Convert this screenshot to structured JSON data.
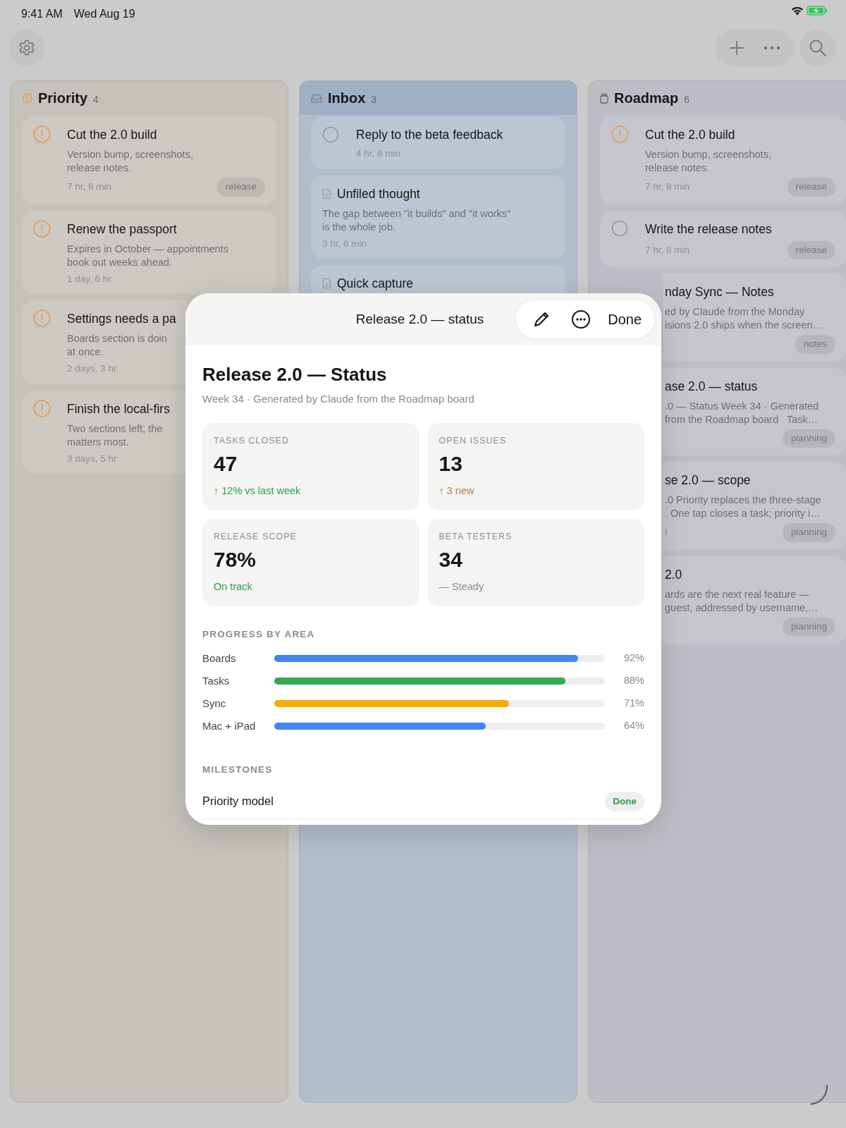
{
  "status_bar": {
    "time": "9:41 AM",
    "date": "Wed Aug 19"
  },
  "columns": [
    {
      "kind": "priority",
      "name": "Priority",
      "count": "4",
      "selected": false,
      "color": "#c5c1bb",
      "cards": [
        {
          "kind": "priority",
          "title": "Cut the 2.0 build",
          "description": "Version bump, screenshots,\nrelease notes.",
          "meta": "7 hr, 8 min",
          "tag": "release",
          "clipped": false
        },
        {
          "kind": "priority",
          "title": "Renew the passport",
          "description": "Expires in October — appointments\nbook out weeks ahead.",
          "meta": "1 day, 6 hr",
          "clipped": false
        },
        {
          "kind": "priority",
          "title": "Settings needs a pa",
          "description": "Boards section is doin\nat once.",
          "meta": "2 days, 3 hr",
          "clipped": true
        },
        {
          "kind": "priority",
          "title": "Finish the local-firs",
          "description": "Two sections left; the\nmatters most.",
          "meta": "3 days, 5 hr",
          "clipped": true
        }
      ]
    },
    {
      "kind": "inbox",
      "name": "Inbox",
      "count": "3",
      "selected": true,
      "color": "#b2bdcc",
      "cards": [
        {
          "kind": "task",
          "title": "Reply to the beta feedback",
          "meta": "4 hr, 8 min",
          "clipped": false
        },
        {
          "kind": "note",
          "title": "Unfiled thought",
          "description": "The gap between \"it builds\" and \"it works\"\nis the whole job.",
          "meta": "3 hr, 8 min",
          "clipped": false
        },
        {
          "kind": "note",
          "title": "Quick capture",
          "clipped": false
        }
      ]
    },
    {
      "kind": "project",
      "name": "Roadmap",
      "count": "6",
      "selected": false,
      "color": "#bdbec5",
      "cards": [
        {
          "kind": "priority",
          "title": "Cut the 2.0 build",
          "description": "Version bump, screenshots,\nrelease notes.",
          "meta": "7 hr, 8 min",
          "tag": "release",
          "clipped": false
        },
        {
          "kind": "task",
          "title": "Write the release notes",
          "meta": "7 hr, 8 min",
          "tag": "release",
          "clipped": false
        },
        {
          "kind": "note",
          "title": "nday Sync — Notes",
          "description": "ed by Claude from the Monday\nisions 2.0 ships when the screen…",
          "tag": "notes",
          "clipped": true
        },
        {
          "kind": "note",
          "title": "ase 2.0 — status",
          "description": ".0 — Status Week 34 · Generated\nfrom the Roadmap board   Task…",
          "tag": "planning",
          "clipped": true
        },
        {
          "kind": "note",
          "title": "se 2.0 — scope",
          "description": ".0 Priority replaces the three-stage\n. One tap closes a task; priority i…",
          "meta": "r",
          "tag": "planning",
          "clipped": true
        },
        {
          "kind": "note",
          "title": "2.0",
          "description": "ards are the next real feature —\nguest, addressed by username,…",
          "tag": "planning",
          "clipped": true
        }
      ]
    }
  ],
  "sheet": {
    "header_title": "Release 2.0 — status",
    "done": "Done",
    "title": "Release 2.0 — Status",
    "subtitle": "Week 34 · Generated by Claude from the Roadmap board",
    "stats": [
      {
        "label": "TASKS CLOSED",
        "value": "47",
        "note": "↑ 12% vs last week",
        "color": "#2e9e48"
      },
      {
        "label": "OPEN ISSUES",
        "value": "13",
        "note": "↑ 3 new",
        "color": "#b7793a"
      },
      {
        "label": "RELEASE SCOPE",
        "value": "78%",
        "note": "On track",
        "color": "#2e9e48"
      },
      {
        "label": "BETA TESTERS",
        "value": "34",
        "note": "— Steady",
        "color": "#8a8a8a"
      }
    ],
    "progress_title": "PROGRESS BY AREA",
    "areas": [
      {
        "name": "Boards",
        "level": 0.92,
        "reading": "92%",
        "color": "#4285f4"
      },
      {
        "name": "Tasks",
        "level": 0.88,
        "reading": "88%",
        "color": "#34a853"
      },
      {
        "name": "Sync",
        "level": 0.71,
        "reading": "71%",
        "color": "#f9ab00"
      },
      {
        "name": "Mac + iPad",
        "level": 0.64,
        "reading": "64%",
        "color": "#4285f4"
      }
    ],
    "milestones_title": "MILESTONES",
    "milestones": [
      {
        "name": "Priority model",
        "status": "Done",
        "kind": "done"
      }
    ]
  }
}
